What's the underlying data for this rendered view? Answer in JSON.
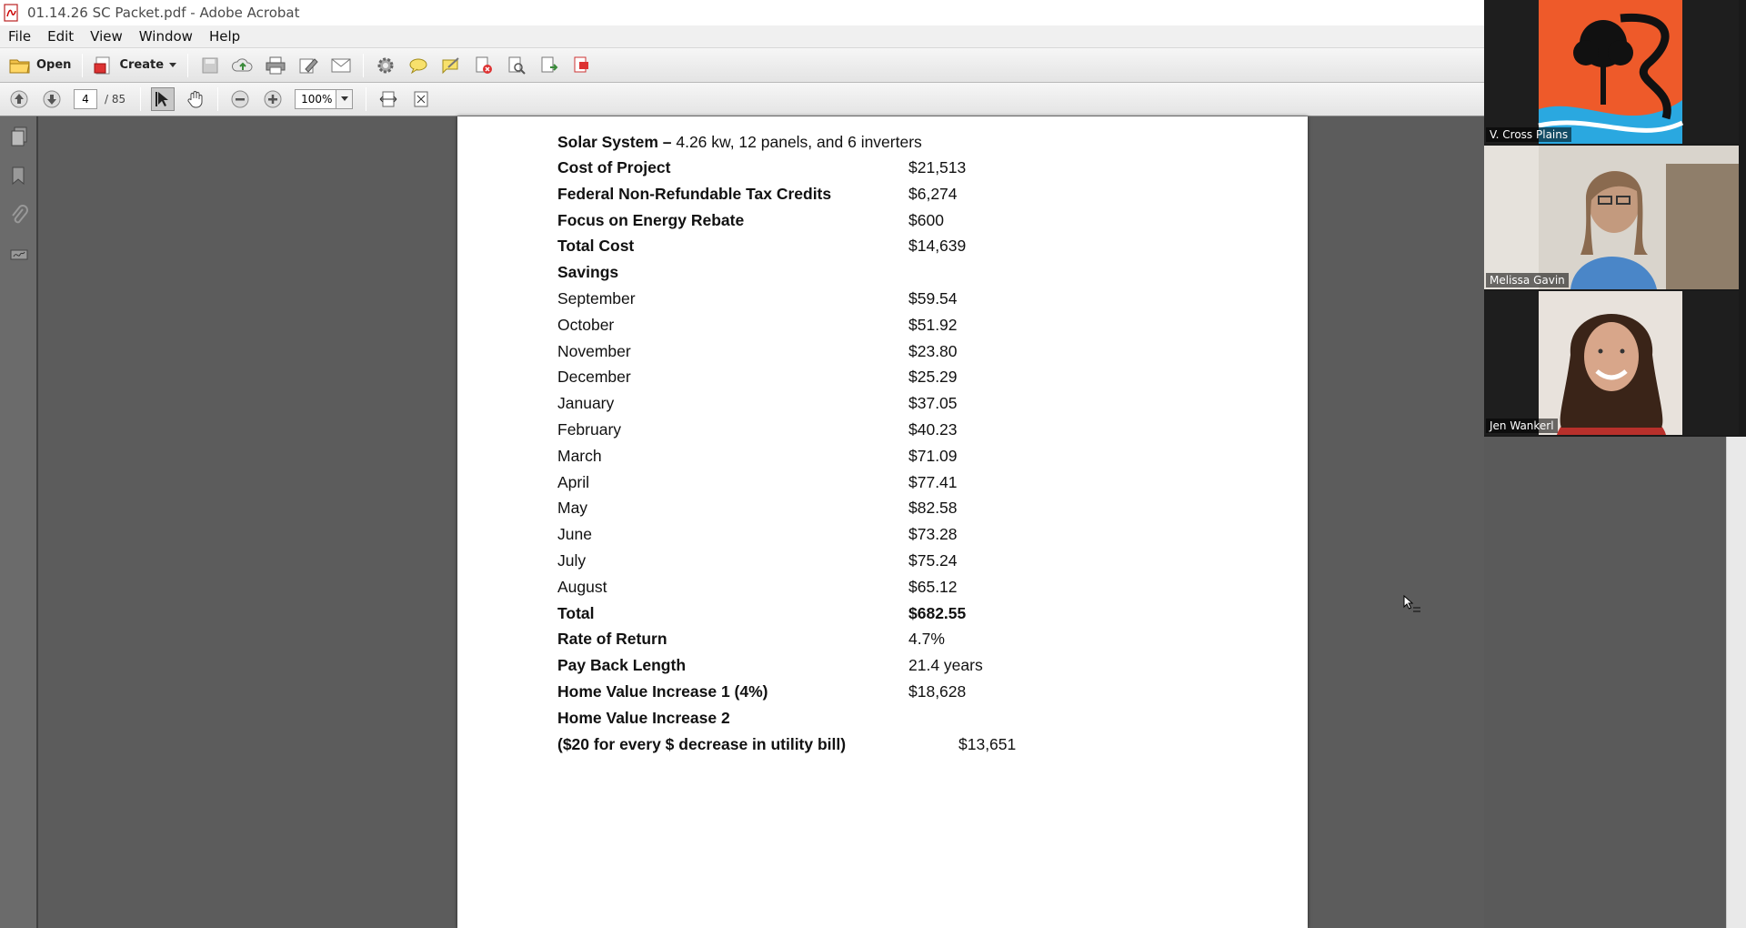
{
  "window": {
    "title": "01.14.26 SC Packet.pdf - Adobe Acrobat"
  },
  "menu": [
    "File",
    "Edit",
    "View",
    "Window",
    "Help"
  ],
  "toolbar": {
    "open_label": "Open",
    "create_label": "Create",
    "current_page": "4",
    "total_pages": "/ 85",
    "zoom": "100%"
  },
  "document": {
    "heading_bold": "Solar System –",
    "heading_rest": " 4.26 kw, 12 panels, and 6 inverters",
    "rows": [
      {
        "label": "Cost of Project",
        "value": "$21,513"
      },
      {
        "label": "Federal Non-Refundable Tax Credits",
        "value": "$6,274"
      },
      {
        "label": "Focus on Energy Rebate",
        "value": "$600"
      },
      {
        "label": "Total Cost",
        "value": "$14,639"
      },
      {
        "label": "Savings",
        "value": ""
      },
      {
        "label": "September",
        "value": "$59.54"
      },
      {
        "label": "October",
        "value": "$51.92"
      },
      {
        "label": "November",
        "value": "$23.80"
      },
      {
        "label": "December",
        "value": "$25.29"
      },
      {
        "label": "January",
        "value": "$37.05"
      },
      {
        "label": "February",
        "value": "$40.23"
      },
      {
        "label": "March",
        "value": "$71.09"
      },
      {
        "label": "April",
        "value": "$77.41"
      },
      {
        "label": "May",
        "value": "$82.58"
      },
      {
        "label": "June",
        "value": "$73.28"
      },
      {
        "label": "July",
        "value": "$75.24"
      },
      {
        "label": "August",
        "value": "$65.12"
      },
      {
        "label": "Total",
        "value": "$682.55"
      },
      {
        "label": "Rate of Return",
        "value": "4.7%"
      },
      {
        "label": "Pay Back Length",
        "value": "21.4 years"
      },
      {
        "label": "Home Value Increase 1 (4%)",
        "value": "$18,628"
      },
      {
        "label": "Home Value Increase 2",
        "value": ""
      },
      {
        "label": "($20 for every $ decrease in utility bill)",
        "value": "$13,651"
      }
    ]
  },
  "participants": [
    {
      "name": "V. Cross Plains"
    },
    {
      "name": "Melissa Gavin"
    },
    {
      "name": "Jen Wankerl"
    }
  ],
  "colors": {
    "page_bg": "#5a5a5a",
    "logo_orange": "#ee5a2a",
    "logo_blue": "#2aa8e0"
  }
}
